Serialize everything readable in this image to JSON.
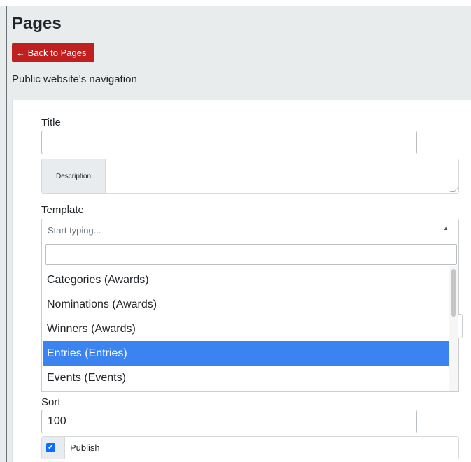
{
  "page": {
    "title": "Pages",
    "back_label": "← Back to Pages",
    "subtitle": "Public website's navigation"
  },
  "form": {
    "title_label": "Title",
    "title_value": "",
    "description_label": "Description",
    "description_value": "",
    "template_label": "Template",
    "template_placeholder": "Start typing...",
    "template_caret": "▲",
    "dropdown_search_value": "",
    "options": [
      "Categories (Awards)",
      "Nominations (Awards)",
      "Winners (Awards)",
      "Entries (Entries)",
      "Events (Events)"
    ],
    "selected_option": "Entries (Entries)",
    "sort_label": "Sort",
    "sort_value": "100",
    "publish_label": "Publish",
    "publish_checked": true
  },
  "colors": {
    "back_button": "#c01f1f",
    "selected_option_bg": "#3b83f0",
    "header_bg": "#e9ecec",
    "checkbox": "#0d6efd"
  }
}
